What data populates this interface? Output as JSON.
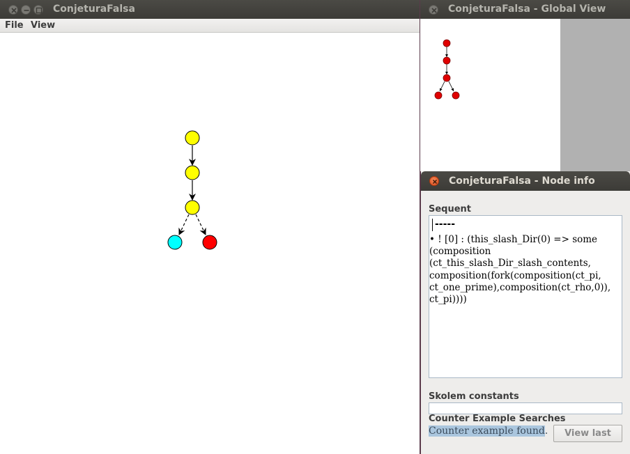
{
  "main_window": {
    "title": "ConjeturaFalsa",
    "menu": [
      "File",
      "View"
    ]
  },
  "global_view": {
    "title": "ConjeturaFalsa - Global View"
  },
  "node_info": {
    "title": "ConjeturaFalsa - Node info",
    "sequent_label": "Sequent",
    "sequent_dashes": "-----",
    "sequent_text": "• ! [0] : (this_slash_Dir(0) => some (composition (ct_this_slash_Dir_slash_contents, composition(fork(composition(ct_pi, ct_one_prime),composition(ct_rho,0)), ct_pi))))",
    "skolem_label": "Skolem constants",
    "skolem_value": "",
    "counter_label": "Counter Example Searches",
    "counter_value": "Counter example found",
    "counter_suffix": ".",
    "view_last_button": "View last"
  },
  "graph": {
    "nodes": [
      {
        "id": "n1",
        "color": "#ffff00"
      },
      {
        "id": "n2",
        "color": "#ffff00"
      },
      {
        "id": "n3",
        "color": "#ffff00"
      },
      {
        "id": "n4",
        "color": "#00ffff"
      },
      {
        "id": "n5",
        "color": "#ff0000"
      }
    ],
    "edges": [
      {
        "from": "n1",
        "to": "n2",
        "style": "solid"
      },
      {
        "from": "n2",
        "to": "n3",
        "style": "solid"
      },
      {
        "from": "n3",
        "to": "n4",
        "style": "dashed"
      },
      {
        "from": "n3",
        "to": "n5",
        "style": "dashed"
      }
    ]
  },
  "global_graph": {
    "node_color": "#e00000"
  }
}
